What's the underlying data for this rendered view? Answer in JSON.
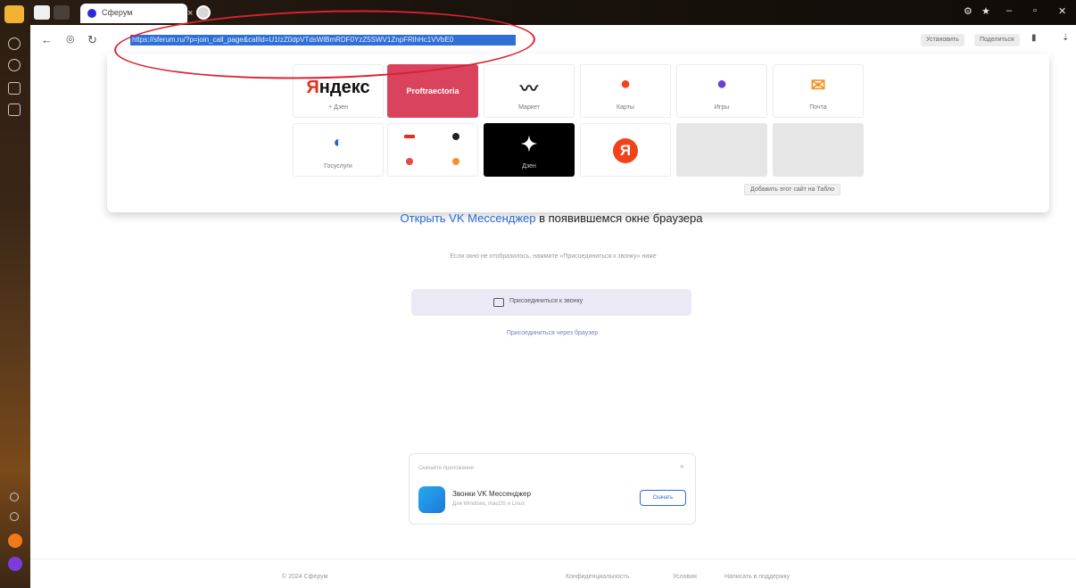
{
  "tab": {
    "title": "Сферум"
  },
  "toolbar": {
    "url": "https://sferum.ru/?p=join_call_page&callId=U1IzZ0dpVTdsWlBmRDF0YzZ5SWV1ZnpFRlhHc1VVbE0",
    "btn_left": "Установить",
    "btn_right": "Поделиться"
  },
  "speed_dial": {
    "tiles": [
      {
        "label": "+ Дзен",
        "glyph": "Яндекс"
      },
      {
        "label": "",
        "glyph": "Proftraectoria"
      },
      {
        "label": "Маркет",
        "glyph": ""
      },
      {
        "label": "Карты",
        "glyph": ""
      },
      {
        "label": "Игры",
        "glyph": ""
      },
      {
        "label": "Почта",
        "glyph": ""
      },
      {
        "label": "Госуслуги",
        "glyph": ""
      },
      {
        "label": "",
        "glyph": ""
      },
      {
        "label": "Дзен",
        "glyph": "✦"
      },
      {
        "label": "",
        "glyph": "Я"
      },
      {
        "label": "",
        "glyph": ""
      },
      {
        "label": "",
        "glyph": ""
      }
    ],
    "add_button": "Добавить этот сайт на Табло"
  },
  "page": {
    "title_link": "Открыть VK Мессенджер",
    "title_rest": " в появившемся окне браузера",
    "hint": "Если окно не отобразилось, нажмите «Присоединиться к звонку» ниже",
    "join_button": "Присоединиться к звонку",
    "browser_link": "Присоединиться через браузер"
  },
  "app_card": {
    "header": "Скачайте приложение",
    "name": "Звонки VK Мессенджер",
    "subtitle": "Для Windows, macOS и Linux",
    "open_button": "Скачать"
  },
  "footer": {
    "copyright": "© 2024 Сферум",
    "links": [
      "Конфиденциальность",
      "Условия",
      "Написать в поддержку"
    ]
  },
  "colors": {
    "annotation": "#d8222e",
    "accent": "#2a6ad8",
    "url_selection": "#2f6fd6"
  }
}
